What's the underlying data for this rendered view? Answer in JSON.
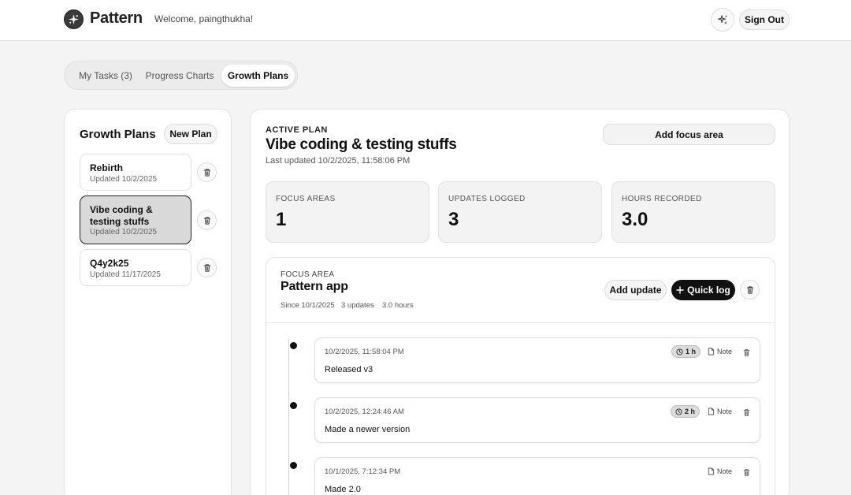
{
  "header": {
    "brand": "Pattern",
    "welcome": "Welcome, paingthukha!",
    "sign_out_label": "Sign Out",
    "theme_icon": "sparkle-icon"
  },
  "tabs": [
    {
      "label": "My Tasks (3)",
      "active": false
    },
    {
      "label": "Progress Charts",
      "active": false
    },
    {
      "label": "Growth Plans",
      "active": true
    }
  ],
  "sidebar": {
    "title": "Growth Plans",
    "new_plan_label": "New Plan",
    "plans": [
      {
        "name": "Rebirth",
        "updated": "Updated 10/2/2025",
        "selected": false
      },
      {
        "name": "Vibe coding & testing stuffs",
        "updated": "Updated 10/2/2025",
        "selected": true
      },
      {
        "name": "Q4y2k25",
        "updated": "Updated 11/17/2025",
        "selected": false
      }
    ]
  },
  "active_plan": {
    "label": "ACTIVE PLAN",
    "title": "Vibe coding & testing stuffs",
    "last_updated": "Last updated 10/2/2025, 11:58:06 PM",
    "add_focus_label": "Add focus area",
    "stats": [
      {
        "label": "FOCUS AREAS",
        "value": "1"
      },
      {
        "label": "UPDATES LOGGED",
        "value": "3"
      },
      {
        "label": "HOURS RECORDED",
        "value": "3.0"
      }
    ]
  },
  "focus_area": {
    "label": "FOCUS AREA",
    "title": "Pattern app",
    "since": "Since 10/1/2025",
    "updates": "3 updates",
    "hours": "3.0 hours",
    "add_update_label": "Add update",
    "quick_log_label": "Quick log",
    "entries": [
      {
        "time": "10/2/2025, 11:58:04 PM",
        "text": "Released v3",
        "hours": "1 h",
        "note_label": "Note"
      },
      {
        "time": "10/2/2025, 12:24:46 AM",
        "text": "Made a newer version",
        "hours": "2 h",
        "note_label": "Note"
      },
      {
        "time": "10/1/2025, 7:12:34 PM",
        "text": "Made 2.0",
        "hours": "",
        "note_label": "Note"
      }
    ]
  }
}
